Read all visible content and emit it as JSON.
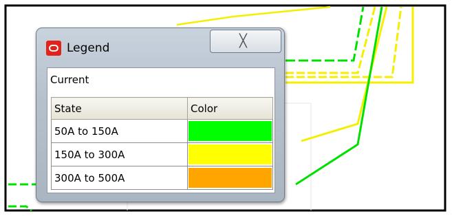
{
  "legend_window": {
    "title": "Legend",
    "close_glyph": "╳",
    "group_label": "Current",
    "columns": [
      "State",
      "Color"
    ],
    "rows": [
      {
        "state": "50A to 150A",
        "color": "#00ff00"
      },
      {
        "state": "150A to 300A",
        "color": "#ffff00"
      },
      {
        "state": "300A to 500A",
        "color": "#ffa500"
      }
    ]
  },
  "map": {
    "line_colors": {
      "green": "#00e000",
      "yellow": "#f4ee00",
      "border": "#000000"
    }
  },
  "icons": {
    "app": "oracle-logo-icon",
    "close": "close-icon"
  }
}
